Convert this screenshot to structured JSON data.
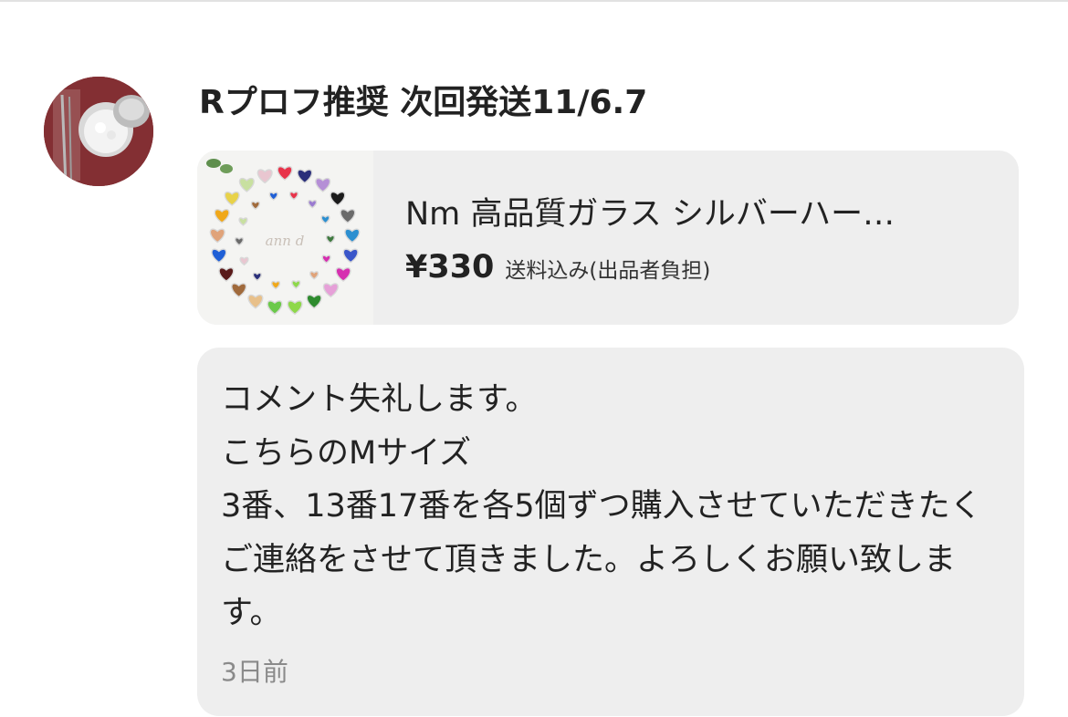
{
  "comment": {
    "user": {
      "name": "Rプロフ推奨 次回発送11/6.7",
      "avatar_icon": "user-avatar"
    },
    "product": {
      "thumbnail_icon": "heart-gem-wreath-image",
      "title": "Nm 高品質ガラス シルバーハー…",
      "price": "¥330",
      "shipping": "送料込み(出品者負担)"
    },
    "message": {
      "text": "コメント失礼します。\nこちらのMサイズ\n3番、13番17番を各5個ずつ購入させていただきたくご連絡をさせて頂きました。よろしくお願い致します。",
      "timestamp": "3日前"
    }
  },
  "colors": {
    "bubble_background": "#eeeeee",
    "text_primary": "#222222",
    "text_muted": "#8a8a8a",
    "avatar_background": "#7c2a2e"
  }
}
